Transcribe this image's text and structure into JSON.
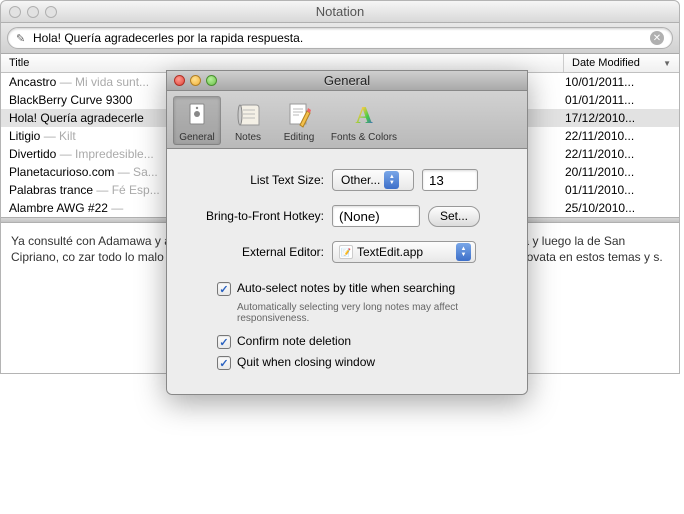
{
  "window": {
    "title": "Notation",
    "search_value": "Hola! Quería agradecerles por la rapida respuesta."
  },
  "columns": {
    "title": "Title",
    "date": "Date Modified"
  },
  "notes": [
    {
      "title": "Ancastro",
      "sub": " — Mi vida sunt...",
      "date": "10/01/2011..."
    },
    {
      "title": "BlackBerry Curve 9300",
      "sub": "",
      "date": "01/01/2011..."
    },
    {
      "title": "Hola! Quería agradecerle",
      "sub": "",
      "date": "17/12/2010...",
      "selected": true
    },
    {
      "title": "Litigio",
      "sub": " — Kilt",
      "date": "22/11/2010..."
    },
    {
      "title": "Divertido",
      "sub": " — Impredesible...",
      "date": "22/11/2010..."
    },
    {
      "title": "Planetacurioso.com",
      "sub": " — Sa...",
      "date": "20/11/2010..."
    },
    {
      "title": "Palabras trance",
      "sub": " — Fé Esp...",
      "date": "01/11/2010..."
    },
    {
      "title": "Alambre AWG #22",
      "sub": " — ",
      "date": "25/10/2010..."
    }
  ],
  "note_body": "Ya consulté con Adamawa y                                                                                             a con mucha fuerza que está enviando una gran                                                                                           el. Debo hacer esta y luego la de San Cipriano, co                                                                                          zar todo lo malo que ya nos envió? Hay que hacer lim                                                                                         de preguntas, pero soy muy novata en estos temas y                                                                                          s.",
  "sheet": {
    "title": "General",
    "tabs": [
      {
        "label": "General",
        "selected": true
      },
      {
        "label": "Notes"
      },
      {
        "label": "Editing"
      },
      {
        "label": "Fonts & Colors"
      }
    ],
    "list_text_size_label": "List Text Size:",
    "list_text_size_mode": "Other...",
    "list_text_size_value": "13",
    "hotkey_label": "Bring-to-Front Hotkey:",
    "hotkey_value": "(None)",
    "hotkey_set_btn": "Set...",
    "editor_label": "External Editor:",
    "editor_value": "TextEdit.app",
    "auto_select_label": "Auto-select notes by title when searching",
    "auto_select_desc": "Automatically selecting very long notes may affect responsiveness.",
    "confirm_delete_label": "Confirm note deletion",
    "quit_close_label": "Quit when closing window"
  }
}
